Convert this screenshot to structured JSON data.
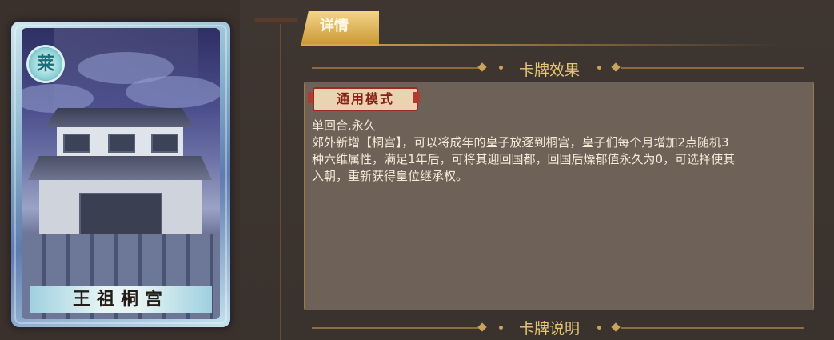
{
  "card": {
    "badge_char": "莱",
    "title": "王祖桐宫"
  },
  "tabs": [
    {
      "label": "详情",
      "active": true
    }
  ],
  "sections": {
    "effect_title": "卡牌效果",
    "description_title": "卡牌说明"
  },
  "effect": {
    "mode_tag": "通用模式",
    "lines": [
      "单回合.永久",
      "郊外新增【桐宫】，可以将成年的皇子放逐到桐宫，皇子们每个月增加2点随机3",
      "种六维属性，满足1年后，可将其迎回国都，回国后燥郁值永久为0，可选择使其",
      "入朝，重新获得皇位继承权。"
    ]
  },
  "colors": {
    "accent_gold": "#e6c679",
    "panel_bg": "#3a322d",
    "box_bg": "#6e6258",
    "tag_red": "#8b1e17"
  }
}
